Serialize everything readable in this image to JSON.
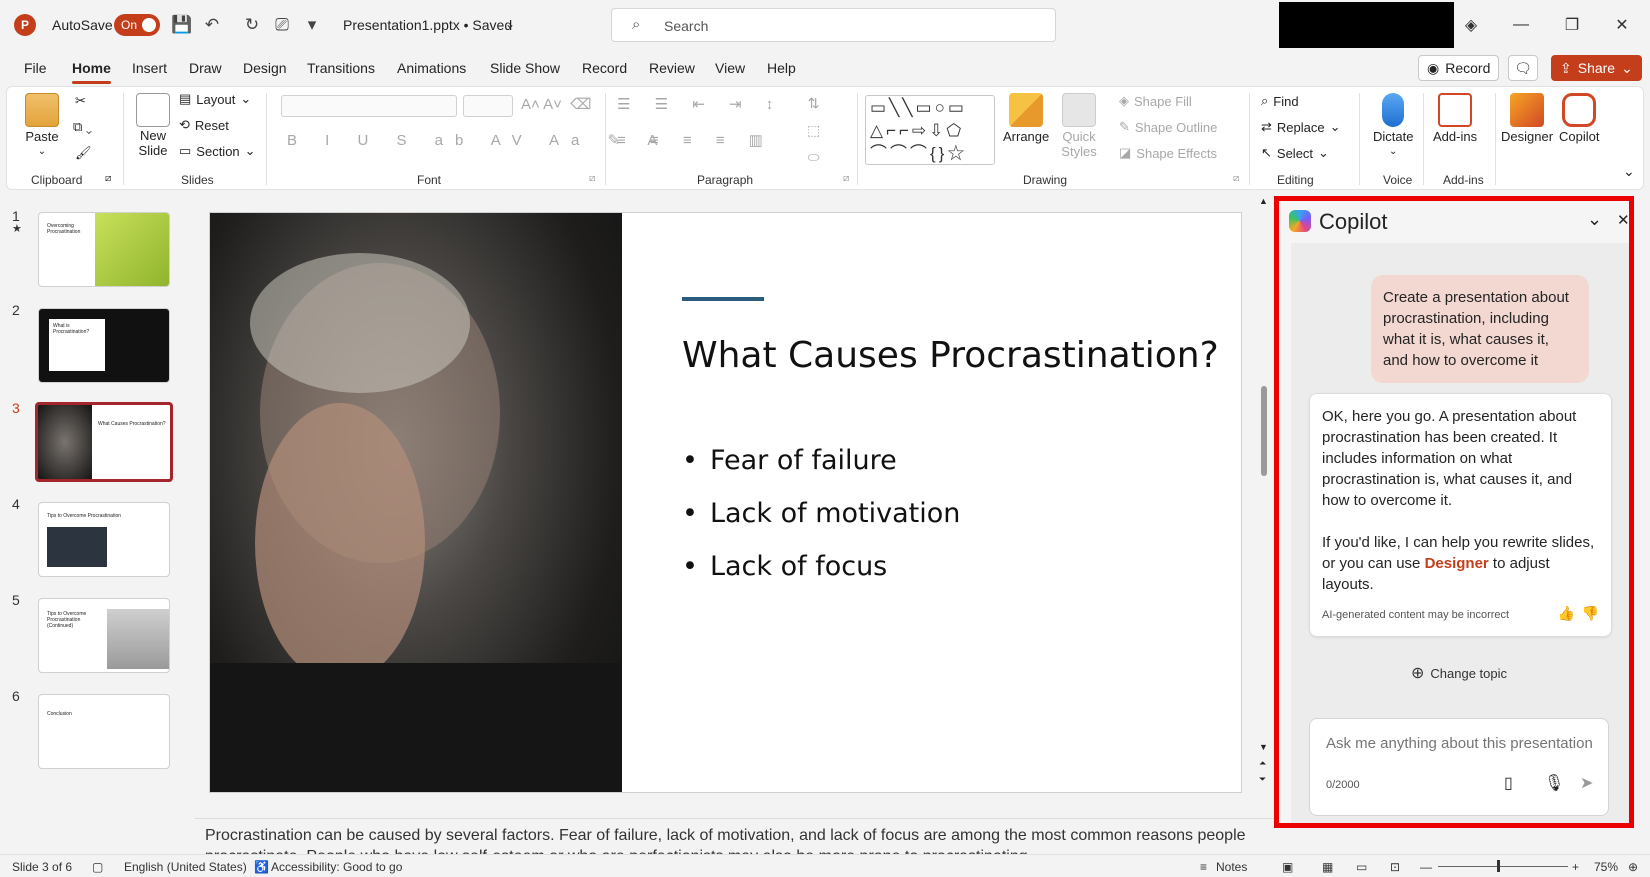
{
  "titlebar": {
    "app_logo": "P",
    "autosave_label": "AutoSave",
    "autosave_state": "On",
    "filename": "Presentation1.pptx • Saved",
    "search_placeholder": "Search"
  },
  "tabs": [
    "File",
    "Home",
    "Insert",
    "Draw",
    "Design",
    "Transitions",
    "Animations",
    "Slide Show",
    "Record",
    "Review",
    "View",
    "Help"
  ],
  "active_tab": "Home",
  "ribbon_buttons": {
    "record": "Record",
    "share": "Share"
  },
  "ribbon": {
    "clipboard": {
      "paste": "Paste",
      "label": "Clipboard"
    },
    "slides": {
      "new_slide": "New Slide",
      "layout": "Layout",
      "reset": "Reset",
      "section": "Section",
      "label": "Slides"
    },
    "font": {
      "label": "Font"
    },
    "paragraph": {
      "label": "Paragraph"
    },
    "drawing": {
      "arrange": "Arrange",
      "quick_styles": "Quick Styles",
      "shape_fill": "Shape Fill",
      "shape_outline": "Shape Outline",
      "shape_effects": "Shape Effects",
      "label": "Drawing"
    },
    "editing": {
      "find": "Find",
      "replace": "Replace",
      "select": "Select",
      "label": "Editing"
    },
    "voice": {
      "dictate": "Dictate",
      "label": "Voice"
    },
    "addins": {
      "addins": "Add-ins",
      "label": "Add-ins"
    },
    "designer": "Designer",
    "copilot": "Copilot"
  },
  "thumbnails": [
    {
      "num": "1",
      "title": "Overcoming Procrastination"
    },
    {
      "num": "2",
      "title": "What is Procrastination?"
    },
    {
      "num": "3",
      "title": "What Causes Procrastination?"
    },
    {
      "num": "4",
      "title": "Tips to Overcome Procrastination"
    },
    {
      "num": "5",
      "title": "Tips to Overcome Procrastination (Continued)"
    },
    {
      "num": "6",
      "title": "Conclusion"
    }
  ],
  "slide": {
    "title": "What Causes Procrastination?",
    "bullets": [
      "Fear of failure",
      "Lack of motivation",
      "Lack of focus"
    ]
  },
  "notes": "Procrastination can be caused by several factors. Fear of failure, lack of motivation, and lack of focus are among the most common reasons people procrastinate. People who have low self-esteem or who are perfectionists may also be more prone to procrastinating.",
  "status": {
    "slide": "Slide 3 of 6",
    "language": "English (United States)",
    "accessibility": "Accessibility: Good to go",
    "notes": "Notes",
    "zoom": "75%"
  },
  "copilot": {
    "title": "Copilot",
    "user_message": "Create a presentation about procrastination, including what it is, what causes it, and how to overcome it",
    "bot_part1": "OK, here you go. A presentation about procrastination has been created. It includes information on what procrastination is, what causes it, and how to overcome it.",
    "bot_part2_pre": "If you'd like, I can help you rewrite slides, or you can use ",
    "bot_link": "Designer",
    "bot_part2_post": " to adjust layouts.",
    "disclaimer": "AI-generated content may be incorrect",
    "change_topic": "Change topic",
    "input_placeholder": "Ask me anything about this presentation",
    "counter": "0/2000"
  },
  "colors": {
    "accent": "#c43e1c",
    "selection": "#a4262c",
    "copilot_border": "#ea0000",
    "slide_accent": "#2b5c7d"
  }
}
